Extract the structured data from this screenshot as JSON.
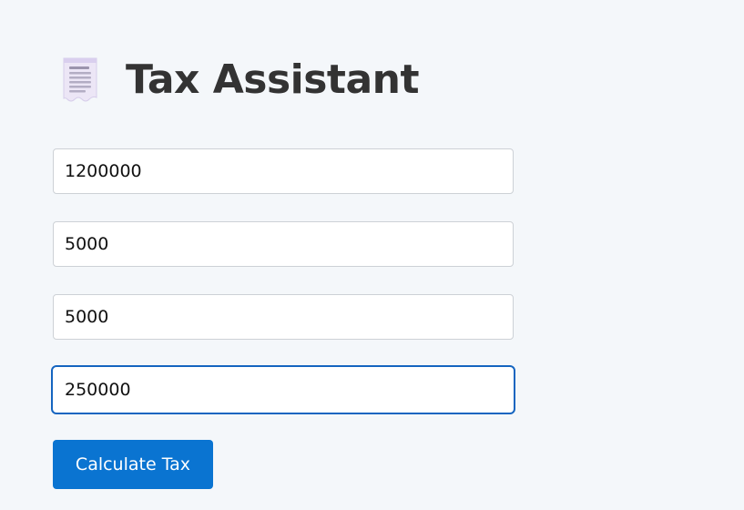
{
  "header": {
    "icon": "receipt-icon",
    "title": "Tax Assistant"
  },
  "form": {
    "fields": [
      {
        "value": "1200000"
      },
      {
        "value": "5000"
      },
      {
        "value": "5000"
      },
      {
        "value": "250000",
        "focused": true
      }
    ],
    "submit_label": "Calculate Tax"
  },
  "colors": {
    "background": "#f4f7fa",
    "title": "#333333",
    "button": "#0a74d1",
    "focus_border": "#1565c0",
    "field_border": "#cdd1d6",
    "icon_paper": "#ece6f6"
  }
}
